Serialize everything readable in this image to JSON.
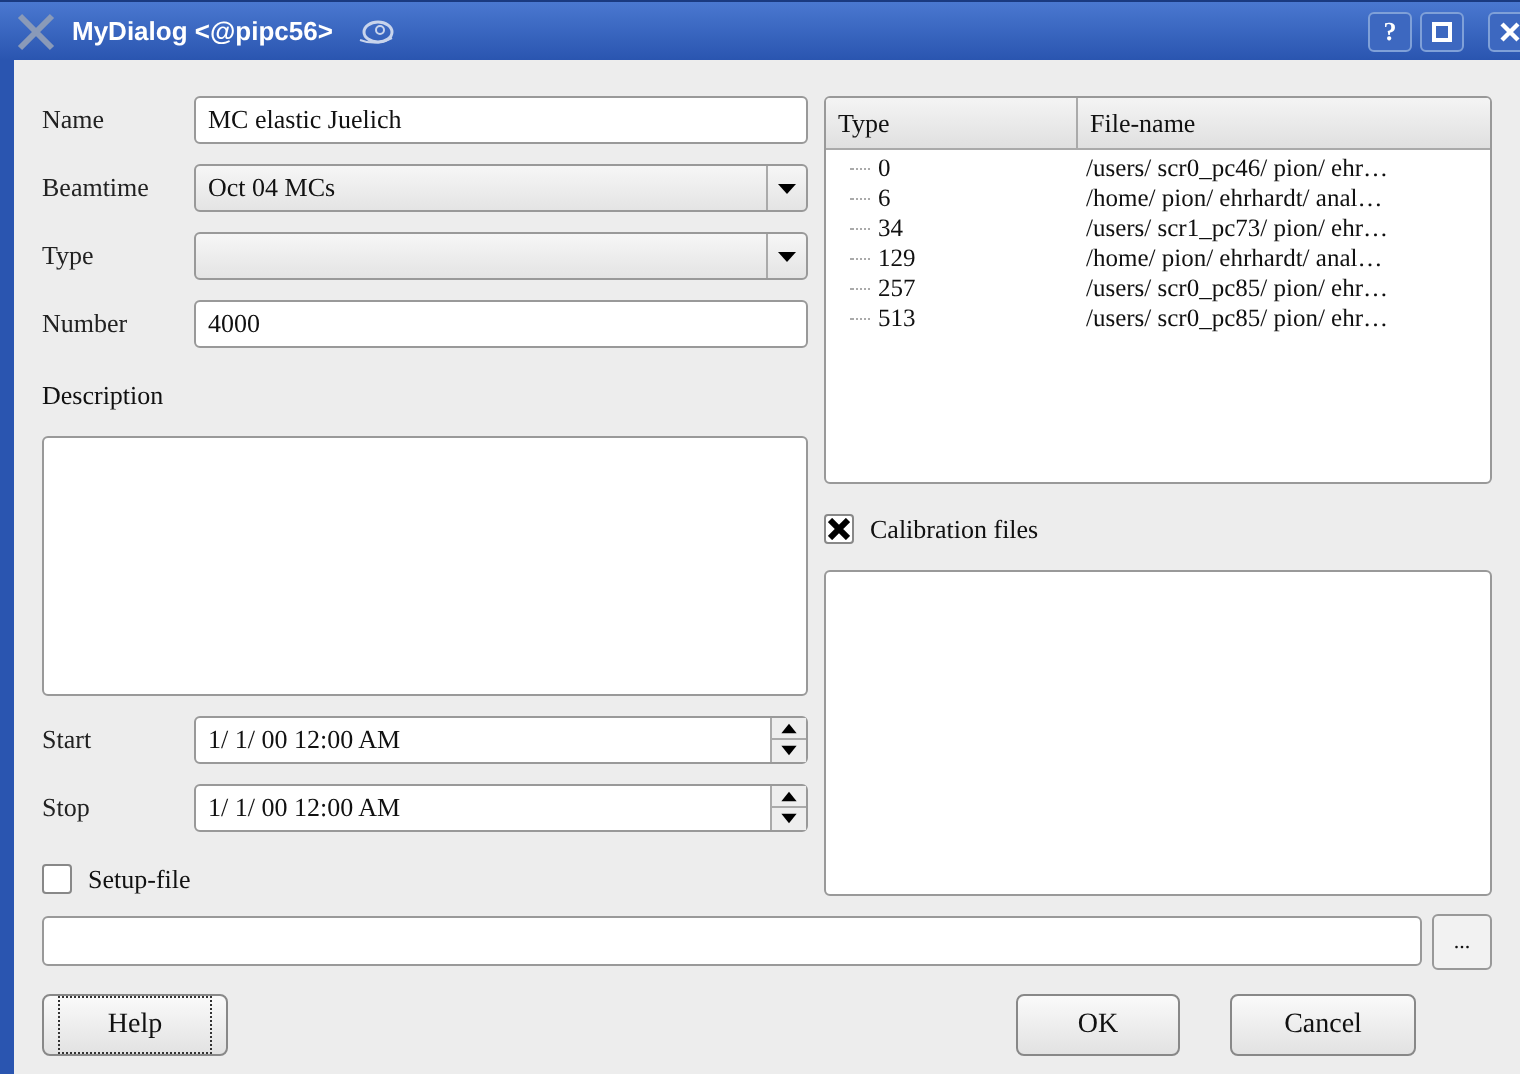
{
  "window": {
    "title": "MyDialog <@pipc56>"
  },
  "title_buttons": [
    {
      "kind": "help",
      "label": "?"
    },
    {
      "kind": "maximize"
    },
    {
      "kind": "close"
    }
  ],
  "name": {
    "label": "Name",
    "value": "MC elastic Juelich"
  },
  "beamtime": {
    "label": "Beamtime",
    "value": "Oct 04 MCs"
  },
  "type": {
    "label": "Type"
  },
  "number": {
    "label": "Number",
    "value": "4000"
  },
  "description": {
    "label": "Description"
  },
  "start": {
    "label": "Start",
    "value": "1/ 1/ 00 12:00 AM"
  },
  "stop": {
    "label": "Stop",
    "value": "1/ 1/ 00 12:00 AM"
  },
  "setup_file": {
    "label": "Setup-file",
    "checked": false
  },
  "browse_button": {
    "label": "..."
  },
  "table": {
    "columns": [
      "Type",
      "File-name"
    ],
    "rows": [
      [
        "0",
        "/users/ scr0_pc46/ pion/ ehr…"
      ],
      [
        "6",
        "/home/ pion/ ehrhardt/ anal…"
      ],
      [
        "34",
        "/users/ scr1_pc73/ pion/ ehr…"
      ],
      [
        "129",
        "/home/ pion/ ehrhardt/ anal…"
      ],
      [
        "257",
        "/users/ scr0_pc85/ pion/ ehr…"
      ],
      [
        "513",
        "/users/ scr0_pc85/ pion/ ehr…"
      ]
    ]
  },
  "calibration_files": {
    "label": "Calibration files",
    "checked": true
  },
  "buttons": [
    {
      "label": "Help",
      "focused": true
    },
    {
      "label": "OK",
      "focused": false
    },
    {
      "label": "Cancel",
      "focused": false
    }
  ]
}
